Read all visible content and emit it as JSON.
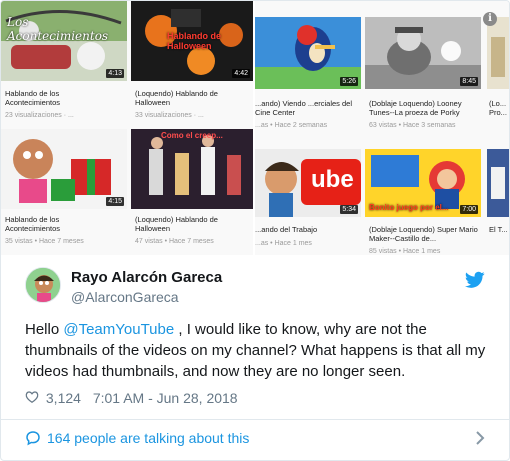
{
  "media": {
    "left_panel": {
      "videos": [
        {
          "title": "Hablando de los Acontecimientos",
          "meta": "23 visualizaciones · ...",
          "duration": "4:13",
          "overlay": "Los Acontecimientos"
        },
        {
          "title": "(Loquendo) Hablando de Halloween",
          "meta": "33 visualizaciones · ...",
          "duration": "4:42",
          "overlay": "Hablando de Halloween"
        },
        {
          "title": "Hablando de los Acontecimientos",
          "meta": "35 vistas • Hace 7 meses",
          "duration": "4:15",
          "overlay": ""
        },
        {
          "title": "(Loquendo) Hablando de Halloween",
          "meta": "47 vistas • Hace 7 meses",
          "duration": "",
          "overlay": "Como el creep..."
        }
      ]
    },
    "right_panel": {
      "videos": [
        {
          "title": "...ando) Viendo ...erciales del Cine Center",
          "meta": "...as • Hace 2 semanas",
          "duration": "5:26",
          "overlay": ""
        },
        {
          "title": "(Doblaje Loquendo) Looney Tunes--La proeza de Porky",
          "meta": "63 vistas • Hace 3 semanas",
          "duration": "8:45",
          "overlay": ""
        },
        {
          "title": "(Lo... Pro...",
          "meta": "",
          "duration": "",
          "overlay": ""
        },
        {
          "title": "...ando del Trabajo",
          "meta": "...as • Hace 1 mes",
          "duration": "5:34",
          "overlay": "ube"
        },
        {
          "title": "(Doblaje Loquendo) Super Mario Maker--Castillo de...",
          "meta": "85 vistas • Hace 1 mes",
          "duration": "7:00",
          "overlay": "Bonito juego por el..."
        },
        {
          "title": "El T...",
          "meta": "",
          "duration": "",
          "overlay": ""
        }
      ]
    },
    "info_icon": "info-icon"
  },
  "tweet": {
    "display_name": "Rayo Alarcón Gareca",
    "handle": "@AlarconGareca",
    "text_prefix": "Hello ",
    "mention": "@TeamYouTube",
    "text_suffix": " , I would like to know, why are not the thumbnails of the videos on my channel? What happens is that all my videos had thumbnails, and now they are no longer seen.",
    "likes": "3,124",
    "timestamp": "7:01 AM - Jun 28, 2018",
    "talking": "164 people are talking about this"
  },
  "colors": {
    "link": "#1b95e0",
    "secondary_text": "#657786",
    "border": "#e1e8ed",
    "twitter_blue": "#1da1f2"
  },
  "icons": [
    "info-icon",
    "twitter-bird-icon",
    "heart-icon",
    "speech-bubble-icon",
    "chevron-right-icon"
  ]
}
